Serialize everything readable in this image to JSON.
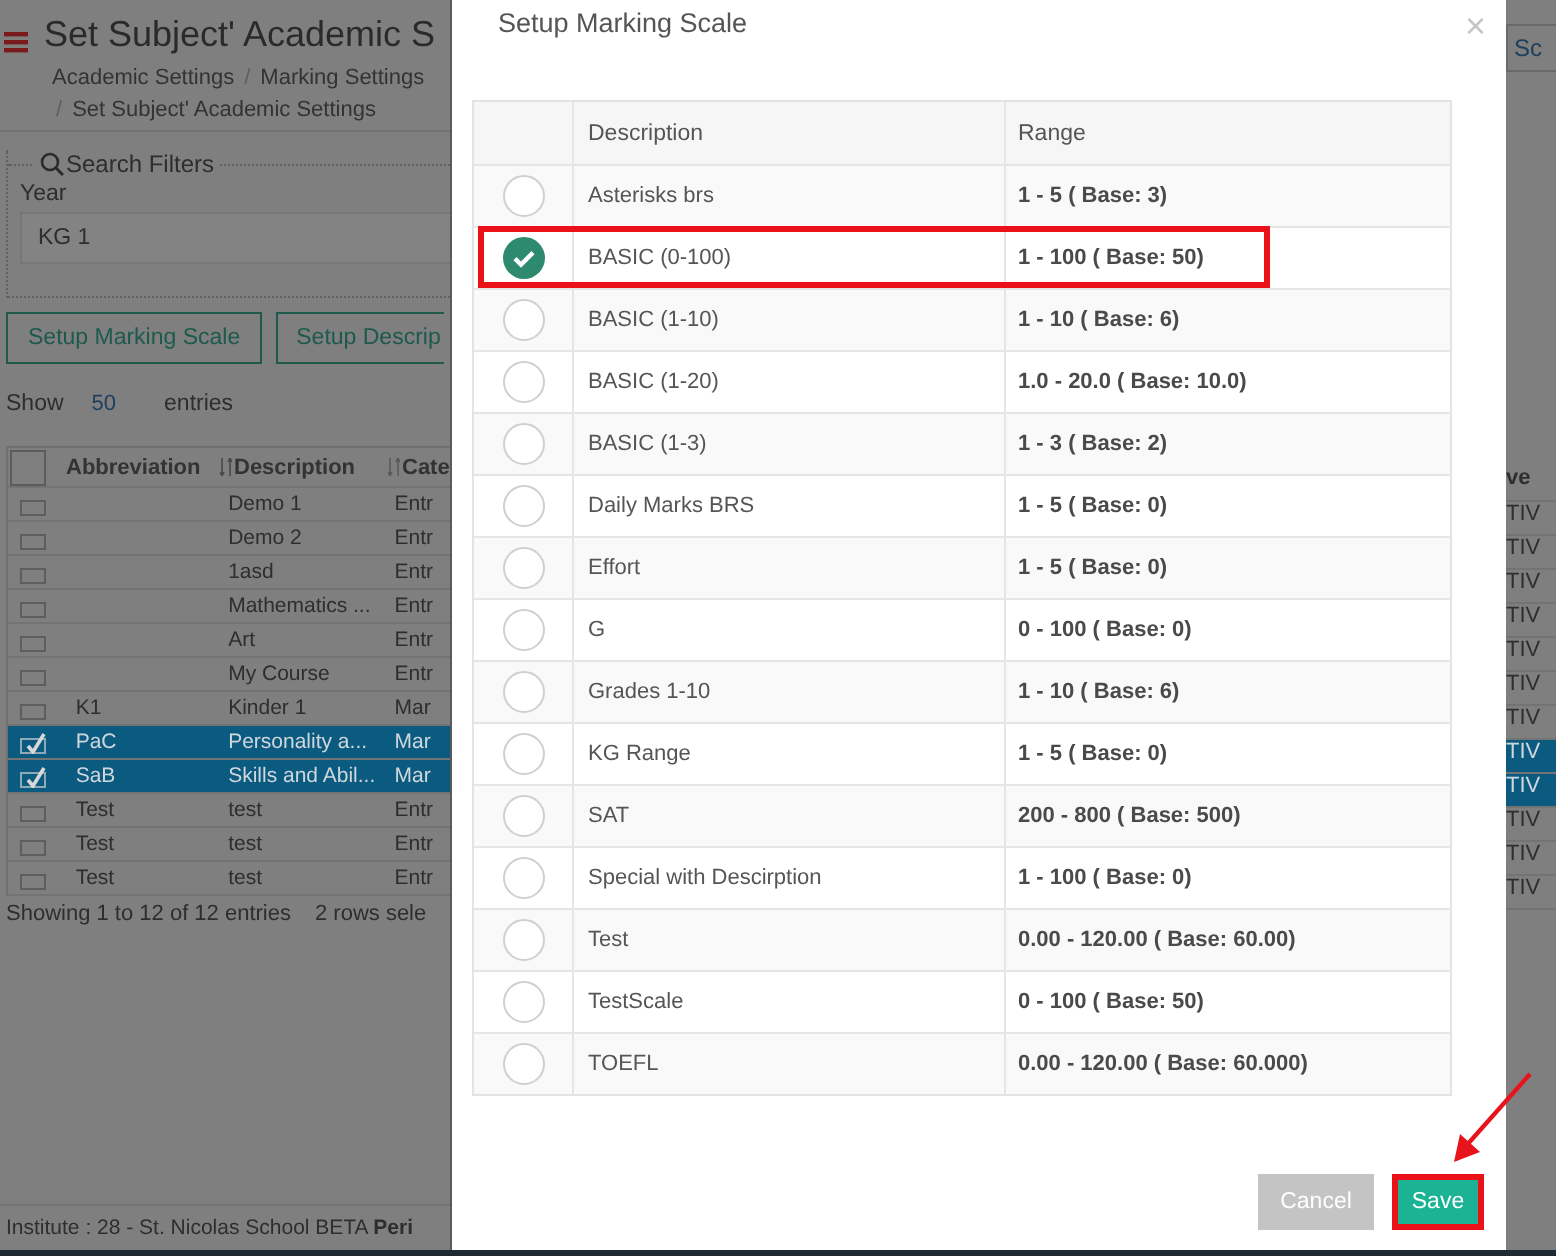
{
  "page": {
    "title": "Set Subject' Academic S",
    "breadcrumb": [
      {
        "label": "Academic Settings"
      },
      {
        "separator": "/",
        "label": "Marking Settings"
      },
      {
        "separator": "/",
        "label": "Set Subject' Academic Settings"
      }
    ],
    "filters": {
      "legend": "Search Filters",
      "year_label": "Year",
      "year_value": "KG 1"
    },
    "buttons": [
      "Setup Marking Scale",
      "Setup Descrip"
    ],
    "length": {
      "show": "Show",
      "value": "50",
      "entries": "entries"
    },
    "right_button": "Sc",
    "table": {
      "all_selected": false,
      "columns": [
        "Abbreviation",
        "Description",
        "Cate",
        "ve"
      ],
      "rows": [
        {
          "abbreviation": "",
          "description": "Demo 1",
          "category": "Entr",
          "column_4": "TIV",
          "selected": false
        },
        {
          "abbreviation": "",
          "description": "Demo 2",
          "category": "Entr",
          "column_4": "TIV",
          "selected": false
        },
        {
          "abbreviation": "",
          "description": "1asd",
          "category": "Entr",
          "column_4": "TIV",
          "selected": false
        },
        {
          "abbreviation": "",
          "description": "Mathematics ...",
          "category": "Entr",
          "column_4": "TIV",
          "selected": false
        },
        {
          "abbreviation": "",
          "description": "Art",
          "category": "Entr",
          "column_4": "TIV",
          "selected": false
        },
        {
          "abbreviation": "",
          "description": "My Course",
          "category": "Entr",
          "column_4": "TIV",
          "selected": false
        },
        {
          "abbreviation": "K1",
          "description": "Kinder 1",
          "category": "Mar",
          "column_4": "TIV",
          "selected": false
        },
        {
          "abbreviation": "PaC",
          "description": "Personality a...",
          "category": "Mar",
          "column_4": "TIV",
          "selected": true
        },
        {
          "abbreviation": "SaB",
          "description": "Skills and Abil...",
          "category": "Mar",
          "column_4": "TIV",
          "selected": true
        },
        {
          "abbreviation": "Test",
          "description": "test",
          "category": "Entr",
          "column_4": "TIV",
          "selected": false
        },
        {
          "abbreviation": "Test",
          "description": "test",
          "category": "Entr",
          "column_4": "TIV",
          "selected": false
        },
        {
          "abbreviation": "Test",
          "description": "test",
          "category": "Entr",
          "column_4": "TIV",
          "selected": false
        }
      ]
    },
    "info": "Showing 1 to 12 of 12 entries",
    "selection_info": "2 rows sele",
    "footer": "Institute : 28 - St. Nicolas School BETA **Peri**"
  },
  "modal": {
    "title": "Setup Marking Scale",
    "close": "×",
    "columns": [
      "Description",
      "Range"
    ],
    "scales": [
      {
        "description": "Asterisks brs",
        "range": "1 - 5 ( Base: 3)",
        "selected": false,
        "annotated": false
      },
      {
        "description": "BASIC (0-100)",
        "range": "1 - 100 ( Base: 50)",
        "selected": true,
        "annotated": true
      },
      {
        "description": "BASIC (1-10)",
        "range": "1 - 10 ( Base: 6)",
        "selected": false,
        "annotated": false
      },
      {
        "description": "BASIC (1-20)",
        "range": "1.0 - 20.0 ( Base: 10.0)",
        "selected": false,
        "annotated": false
      },
      {
        "description": "BASIC (1-3)",
        "range": "1 - 3 ( Base: 2)",
        "selected": false,
        "annotated": false
      },
      {
        "description": "Daily Marks BRS",
        "range": "1 - 5 ( Base: 0)",
        "selected": false,
        "annotated": false
      },
      {
        "description": "Effort",
        "range": "1 - 5 ( Base: 0)",
        "selected": false,
        "annotated": false
      },
      {
        "description": "G",
        "range": "0 - 100 ( Base: 0)",
        "selected": false,
        "annotated": false
      },
      {
        "description": "Grades 1-10",
        "range": "1 - 10 ( Base: 6)",
        "selected": false,
        "annotated": false
      },
      {
        "description": "KG Range",
        "range": "1 - 5 ( Base: 0)",
        "selected": false,
        "annotated": false
      },
      {
        "description": "SAT",
        "range": "200 - 800 ( Base: 500)",
        "selected": false,
        "annotated": false
      },
      {
        "description": "Special with Descirption",
        "range": "1 - 100 ( Base: 0)",
        "selected": false,
        "annotated": false
      },
      {
        "description": "Test",
        "range": "0.00 - 120.00 ( Base: 60.00)",
        "selected": false,
        "annotated": false
      },
      {
        "description": "TestScale",
        "range": "0 - 100 ( Base: 50)",
        "selected": false,
        "annotated": false
      },
      {
        "description": "TOEFL",
        "range": "0.00 - 120.00 ( Base: 60.000)",
        "selected": false,
        "annotated": false
      }
    ],
    "buttons": [
      {
        "label": "Cancel",
        "kind": "cancel",
        "annotated": false
      },
      {
        "label": "Save",
        "kind": "save",
        "annotated": true
      }
    ]
  }
}
